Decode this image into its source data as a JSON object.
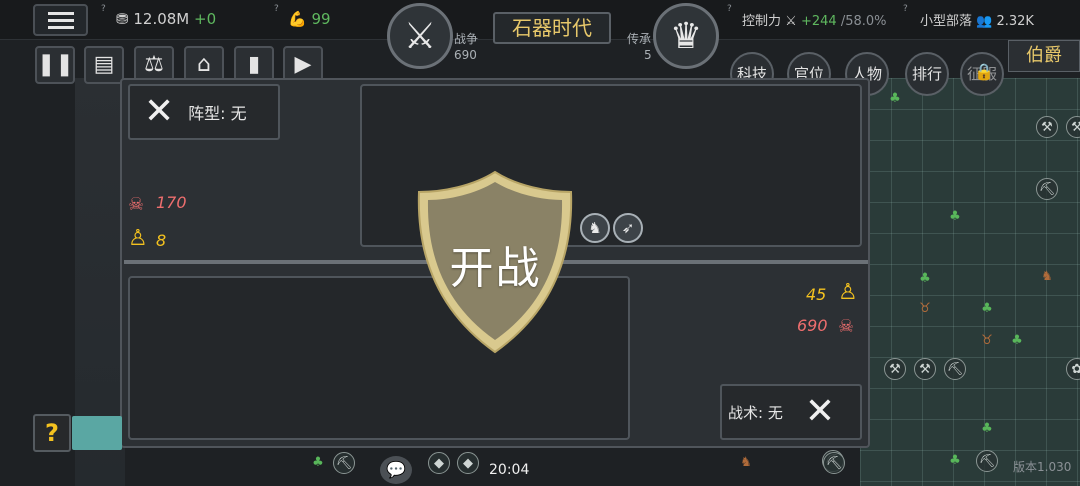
{
  "topbar": {
    "resources": "12.08M",
    "resources_delta": "+0",
    "strength": "99",
    "war_label": "战争",
    "war_value": "690",
    "era_title": "石器时代",
    "legacy_label": "传承",
    "legacy_value": "5",
    "control_label": "控制力",
    "control_delta": "+244",
    "control_pct": "/58.0%",
    "tribe_label": "小型部落",
    "population": "2.32K"
  },
  "toolbar": {
    "pause_icon": "pause-icon",
    "save_icon": "save-icon",
    "justice_icon": "scales-icon",
    "building_icon": "building-icon",
    "book_icon": "book-icon",
    "video_icon": "video-icon"
  },
  "nav": {
    "tech": "科技",
    "office": "官位",
    "people": "人物",
    "ranking": "排行",
    "locked_label": "征服",
    "rank_title": "伯爵"
  },
  "battle": {
    "formation_label": "阵型: 无",
    "our_casualties": "170",
    "our_troops": "8",
    "start_button": "开战",
    "enemy_troops": "45",
    "enemy_casualties": "690",
    "tactic_label": "战术: 无"
  },
  "bottom": {
    "time": "20:04",
    "version": "版本1.030",
    "help": "?"
  },
  "colors": {
    "accent_gold": "#e7c86a",
    "troop_yellow": "#f4c21f",
    "casualty_red": "#ee6e6e",
    "positive_green": "#5fb85f",
    "shield_fill": "#8a8266",
    "shield_rim": "#d9c98e"
  }
}
